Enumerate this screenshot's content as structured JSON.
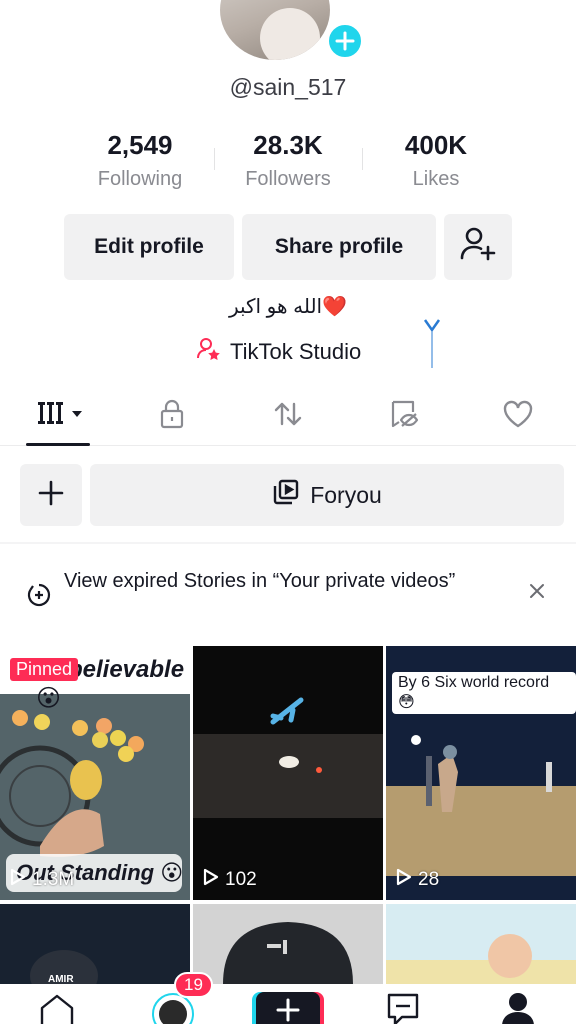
{
  "profile": {
    "username": "@sain_517",
    "bio": "الله هو اکبر❤️",
    "studio_label": "TikTok Studio"
  },
  "stats": [
    {
      "value": "2,549",
      "label": "Following"
    },
    {
      "value": "28.3K",
      "label": "Followers"
    },
    {
      "value": "400K",
      "label": "Likes"
    }
  ],
  "actions": {
    "edit_profile": "Edit profile",
    "share_profile": "Share profile"
  },
  "tabs": [
    {
      "icon": "videos-grid-icon",
      "active": true
    },
    {
      "icon": "lock-icon"
    },
    {
      "icon": "repost-icon"
    },
    {
      "icon": "hidden-eye-icon"
    },
    {
      "icon": "heart-icon"
    }
  ],
  "playlist": {
    "label": "Foryou"
  },
  "notice": {
    "text": "View expired Stories in “Your private videos”"
  },
  "videos": [
    {
      "pinned_label": "Pinned",
      "views": "1.3M",
      "top_text": "Unbelievable 😮",
      "bottom_text": "Out Standing 😮"
    },
    {
      "views": "102"
    },
    {
      "views": "28",
      "caption": "By 6 Six world record 😳"
    },
    {
      "overlay": "AMIR"
    },
    {},
    {}
  ],
  "bottom_nav": {
    "inbox_badge": "19"
  },
  "colors": {
    "accent_red": "#fe2c55",
    "accent_cyan": "#20d5ec",
    "text_primary": "#161823",
    "text_secondary": "#8a8b91",
    "button_bg": "#f1f1f2"
  }
}
